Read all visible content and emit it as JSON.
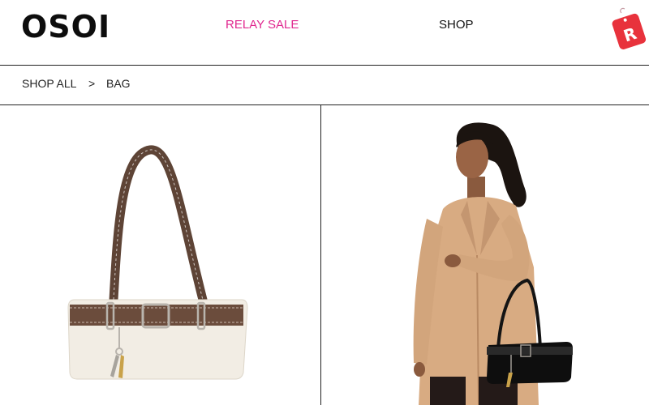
{
  "header": {
    "logo": "OSOI",
    "nav": {
      "relay_sale": "RELAY SALE",
      "shop": "SHOP"
    },
    "cart_badge": "R"
  },
  "breadcrumb": {
    "items": [
      "SHOP ALL",
      ">",
      "BAG"
    ]
  },
  "products": [
    {
      "image": "bag-product-photo"
    },
    {
      "image": "model-with-bag-photo"
    }
  ],
  "colors": {
    "accent": "#e0288f",
    "cart": "#e8323c"
  }
}
